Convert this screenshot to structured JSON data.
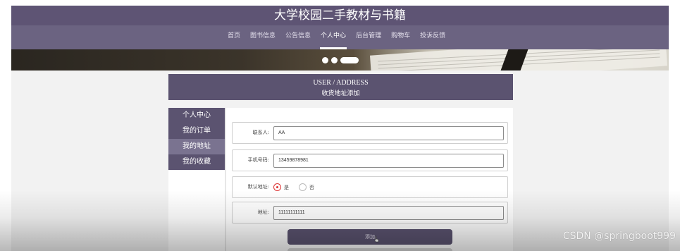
{
  "site": {
    "title": "大学校园二手教材与书籍"
  },
  "nav": {
    "items": [
      {
        "label": "首页"
      },
      {
        "label": "图书信息"
      },
      {
        "label": "公告信息"
      },
      {
        "label": "个人中心",
        "active": true
      },
      {
        "label": "后台管理"
      },
      {
        "label": "购物车"
      },
      {
        "label": "投诉反馈"
      }
    ]
  },
  "banner": {
    "active_slide": 2,
    "slide_count": 3
  },
  "page_header": {
    "en": "USER / ADDRESS",
    "cn": "收货地址添加"
  },
  "sidebar": {
    "items": [
      {
        "label": "个人中心"
      },
      {
        "label": "我的订单"
      },
      {
        "label": "我的地址",
        "selected": true
      },
      {
        "label": "我的收藏"
      }
    ]
  },
  "form": {
    "contact": {
      "label": "联系人:",
      "value": "AA"
    },
    "phone": {
      "label": "手机号码:",
      "value": "13459878981"
    },
    "default": {
      "label": "默认地址:",
      "yes": "是",
      "no": "否",
      "selected": "是"
    },
    "address": {
      "label": "地址:",
      "value": "11111111111"
    },
    "submit_label": "添加"
  },
  "colors": {
    "primary": "#5b5370",
    "nav": "#6b6381",
    "accent_radio": "#dd3333"
  },
  "watermark": "CSDN @springboot999"
}
